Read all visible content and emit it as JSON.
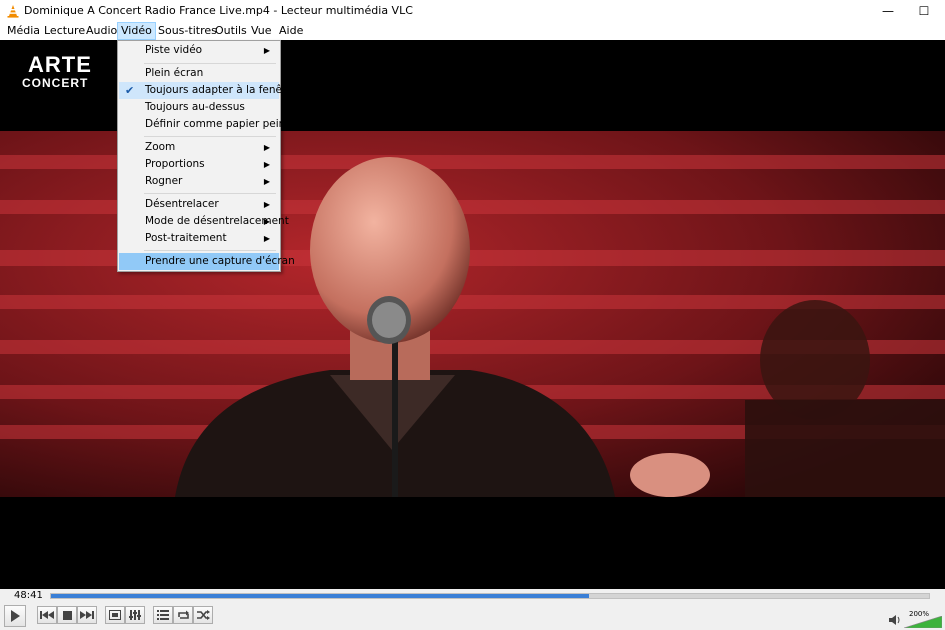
{
  "window": {
    "title": "Dominique A Concert Radio France Live.mp4 - Lecteur multimédia VLC",
    "minimize_glyph": "—",
    "maximize_glyph": "☐"
  },
  "menubar": {
    "items": [
      {
        "label": "Média"
      },
      {
        "label": "Lecture"
      },
      {
        "label": "Audio"
      },
      {
        "label": "Vidéo",
        "active": true
      },
      {
        "label": "Sous-titres"
      },
      {
        "label": "Outils"
      },
      {
        "label": "Vue"
      },
      {
        "label": "Aide"
      }
    ]
  },
  "video_menu": {
    "items": [
      {
        "label": "Piste vidéo",
        "submenu": true
      },
      {
        "label": "Plein écran"
      },
      {
        "label": "Toujours adapter à la fenêtre",
        "checked": true
      },
      {
        "label": "Toujours au-dessus"
      },
      {
        "label": "Définir comme papier peint"
      },
      {
        "label": "Zoom",
        "submenu": true
      },
      {
        "label": "Proportions",
        "submenu": true
      },
      {
        "label": "Rogner",
        "submenu": true
      },
      {
        "label": "Désentrelacer",
        "submenu": true
      },
      {
        "label": "Mode de désentrelacement",
        "submenu": true
      },
      {
        "label": "Post-traitement",
        "submenu": true
      },
      {
        "label": "Prendre une capture d'écran",
        "highlighted": true
      }
    ]
  },
  "overlay": {
    "logo_top": "ARTE",
    "logo_bottom": "CONCERT"
  },
  "playback": {
    "elapsed": "48:41",
    "progress_fraction": 0.613,
    "volume_label": "200%",
    "volume_fraction": 1.0
  },
  "colors": {
    "accent": "#3a7fd6",
    "menu_highlight": "#91c9f7",
    "menu_checked": "#cfe6fb",
    "stage_red": "#8a1a1f"
  },
  "icons": {
    "app": "vlc-cone-icon",
    "controls": [
      "play-icon",
      "previous-icon",
      "stop-icon",
      "next-icon",
      "fullscreen-icon",
      "extended-settings-icon",
      "playlist-icon",
      "loop-icon",
      "shuffle-icon",
      "volume-icon"
    ]
  }
}
